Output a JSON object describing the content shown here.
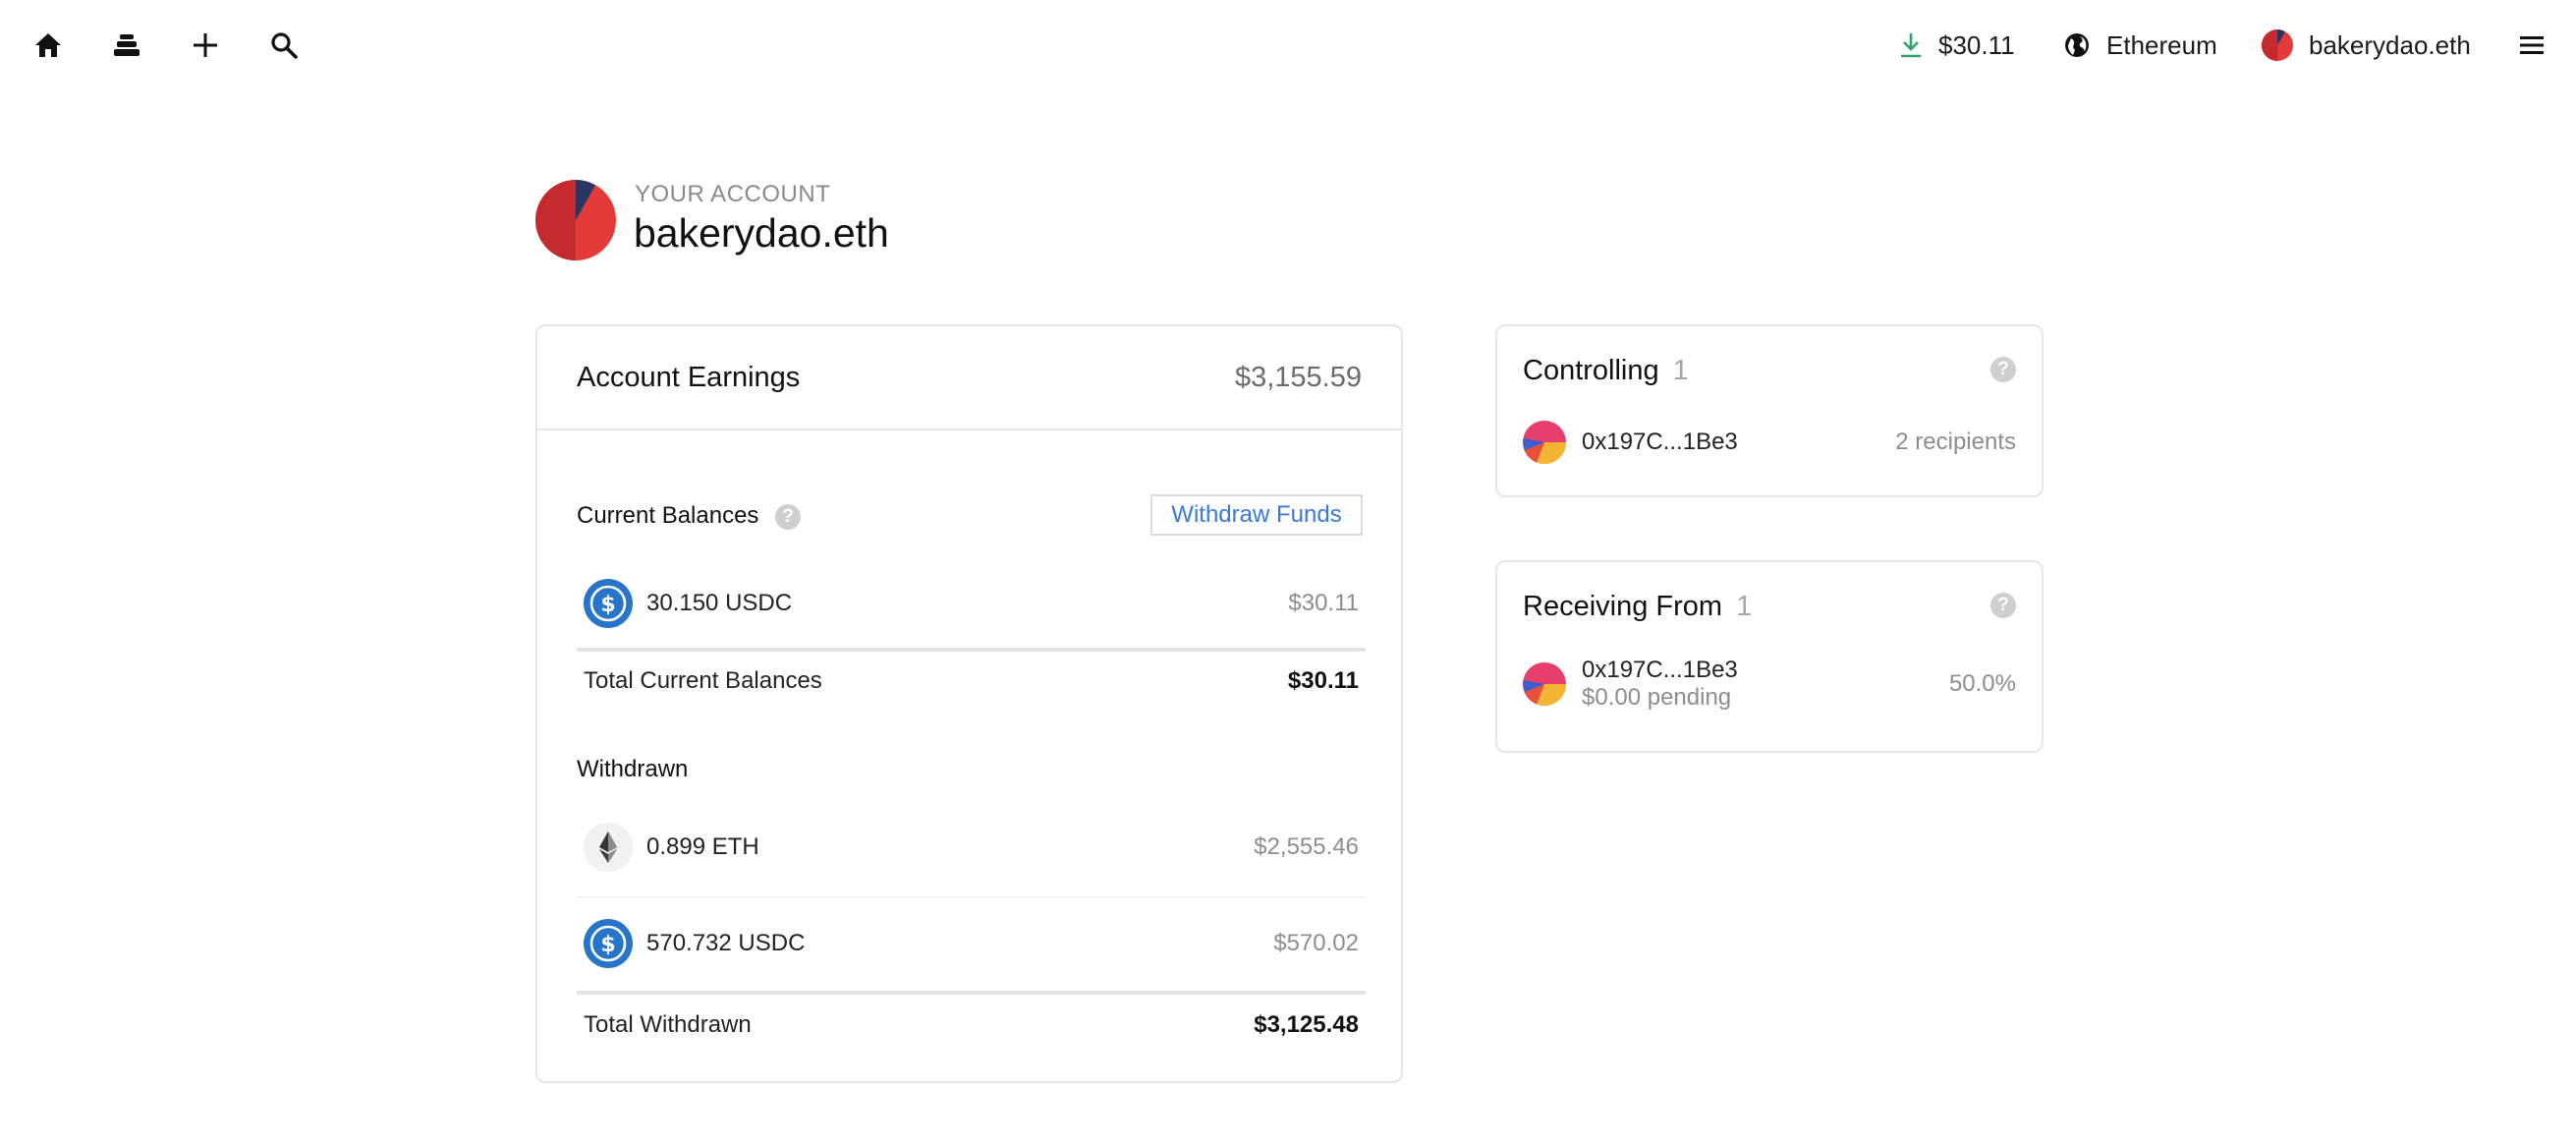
{
  "nav": {
    "icons": [
      "home-icon",
      "layers-icon",
      "plus-icon",
      "search-icon"
    ],
    "balance": "$30.11",
    "network": "Ethereum",
    "account": "bakerydao.eth",
    "colors": {
      "download": "#2fa36b"
    }
  },
  "account": {
    "kicker": "YOUR ACCOUNT",
    "name": "bakerydao.eth"
  },
  "earnings": {
    "title": "Account Earnings",
    "total": "$3,155.59",
    "current_balances": {
      "label": "Current Balances",
      "withdraw_label": "Withdraw Funds",
      "items": [
        {
          "icon": "usdc-icon",
          "amount": "30.150 USDC",
          "usd": "$30.11"
        }
      ],
      "total_label": "Total Current Balances",
      "total_value": "$30.11"
    },
    "withdrawn": {
      "label": "Withdrawn",
      "items": [
        {
          "icon": "eth-icon",
          "amount": "0.899 ETH",
          "usd": "$2,555.46"
        },
        {
          "icon": "usdc-icon",
          "amount": "570.732 USDC",
          "usd": "$570.02"
        }
      ],
      "total_label": "Total Withdrawn",
      "total_value": "$3,125.48"
    }
  },
  "controlling": {
    "title": "Controlling",
    "count": "1",
    "items": [
      {
        "address": "0x197C...1Be3",
        "right": "2 recipients"
      }
    ]
  },
  "receiving": {
    "title": "Receiving From",
    "count": "1",
    "items": [
      {
        "address": "0x197C...1Be3",
        "pending": "$0.00 pending",
        "right": "50.0%"
      }
    ]
  },
  "colors": {
    "accent": "#3b78d8",
    "usdc": "#2775ca"
  }
}
